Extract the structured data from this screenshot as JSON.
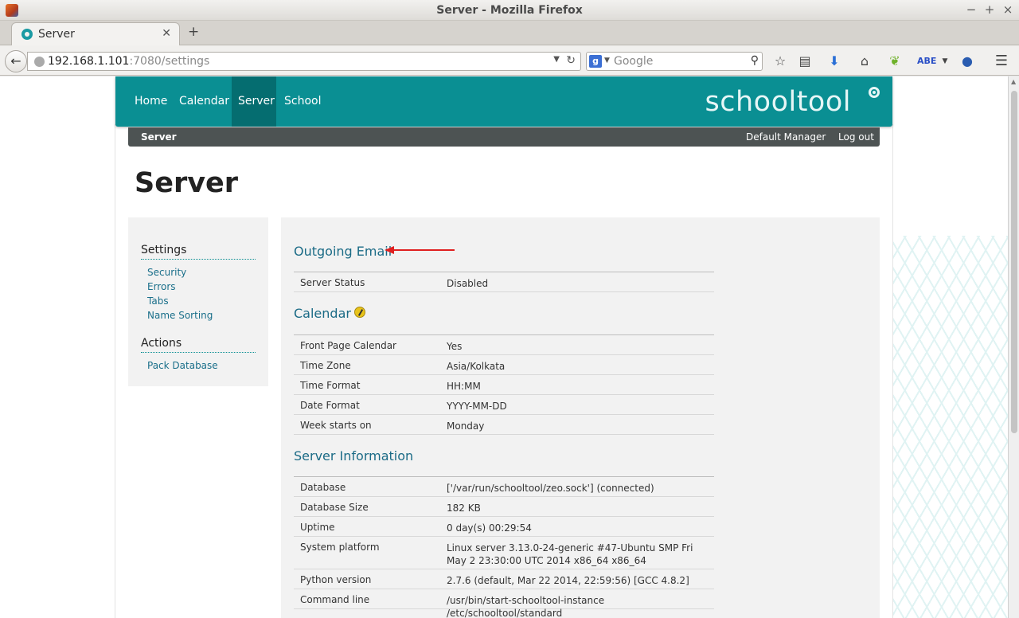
{
  "window": {
    "title": "Server - Mozilla Firefox"
  },
  "tabs": [
    {
      "label": "Server"
    }
  ],
  "navbar": {
    "url_host": "192.168.1.101",
    "url_rest": ":7080/settings",
    "search_placeholder": "Google"
  },
  "site": {
    "nav": [
      "Home",
      "Calendar",
      "Server",
      "School"
    ],
    "active_nav": "Server",
    "brand": "schooltool",
    "brand_color": "#0a8f93",
    "subbar": {
      "left": "Server",
      "user": "Default Manager",
      "logout": "Log out"
    }
  },
  "page": {
    "title": "Server"
  },
  "sidebar": {
    "settings_heading": "Settings",
    "settings_links": [
      "Security",
      "Errors",
      "Tabs",
      "Name Sorting"
    ],
    "actions_heading": "Actions",
    "actions_links": [
      "Pack Database"
    ]
  },
  "sections": {
    "email": {
      "title": "Outgoing Email",
      "rows": [
        {
          "k": "Server Status",
          "v": "Disabled"
        }
      ]
    },
    "calendar": {
      "title": "Calendar",
      "rows": [
        {
          "k": "Front Page Calendar",
          "v": "Yes"
        },
        {
          "k": "Time Zone",
          "v": "Asia/Kolkata"
        },
        {
          "k": "Time Format",
          "v": "HH:MM"
        },
        {
          "k": "Date Format",
          "v": "YYYY-MM-DD"
        },
        {
          "k": "Week starts on",
          "v": "Monday"
        }
      ]
    },
    "server_info": {
      "title": "Server Information",
      "rows": [
        {
          "k": "Database",
          "v": "['/var/run/schooltool/zeo.sock'] (connected)"
        },
        {
          "k": "Database Size",
          "v": "182 KB"
        },
        {
          "k": "Uptime",
          "v": "0 day(s) 00:29:54"
        },
        {
          "k": "System platform",
          "v": "Linux server 3.13.0-24-generic #47-Ubuntu SMP Fri May 2 23:30:00 UTC 2014 x86_64 x86_64"
        },
        {
          "k": "Python version",
          "v": "2.7.6 (default, Mar 22 2014, 22:59:56) [GCC 4.8.2]"
        },
        {
          "k": "Command line",
          "v": "/usr/bin/start-schooltool-instance /etc/schooltool/standard"
        }
      ]
    }
  },
  "annotation_color": "#e02020"
}
